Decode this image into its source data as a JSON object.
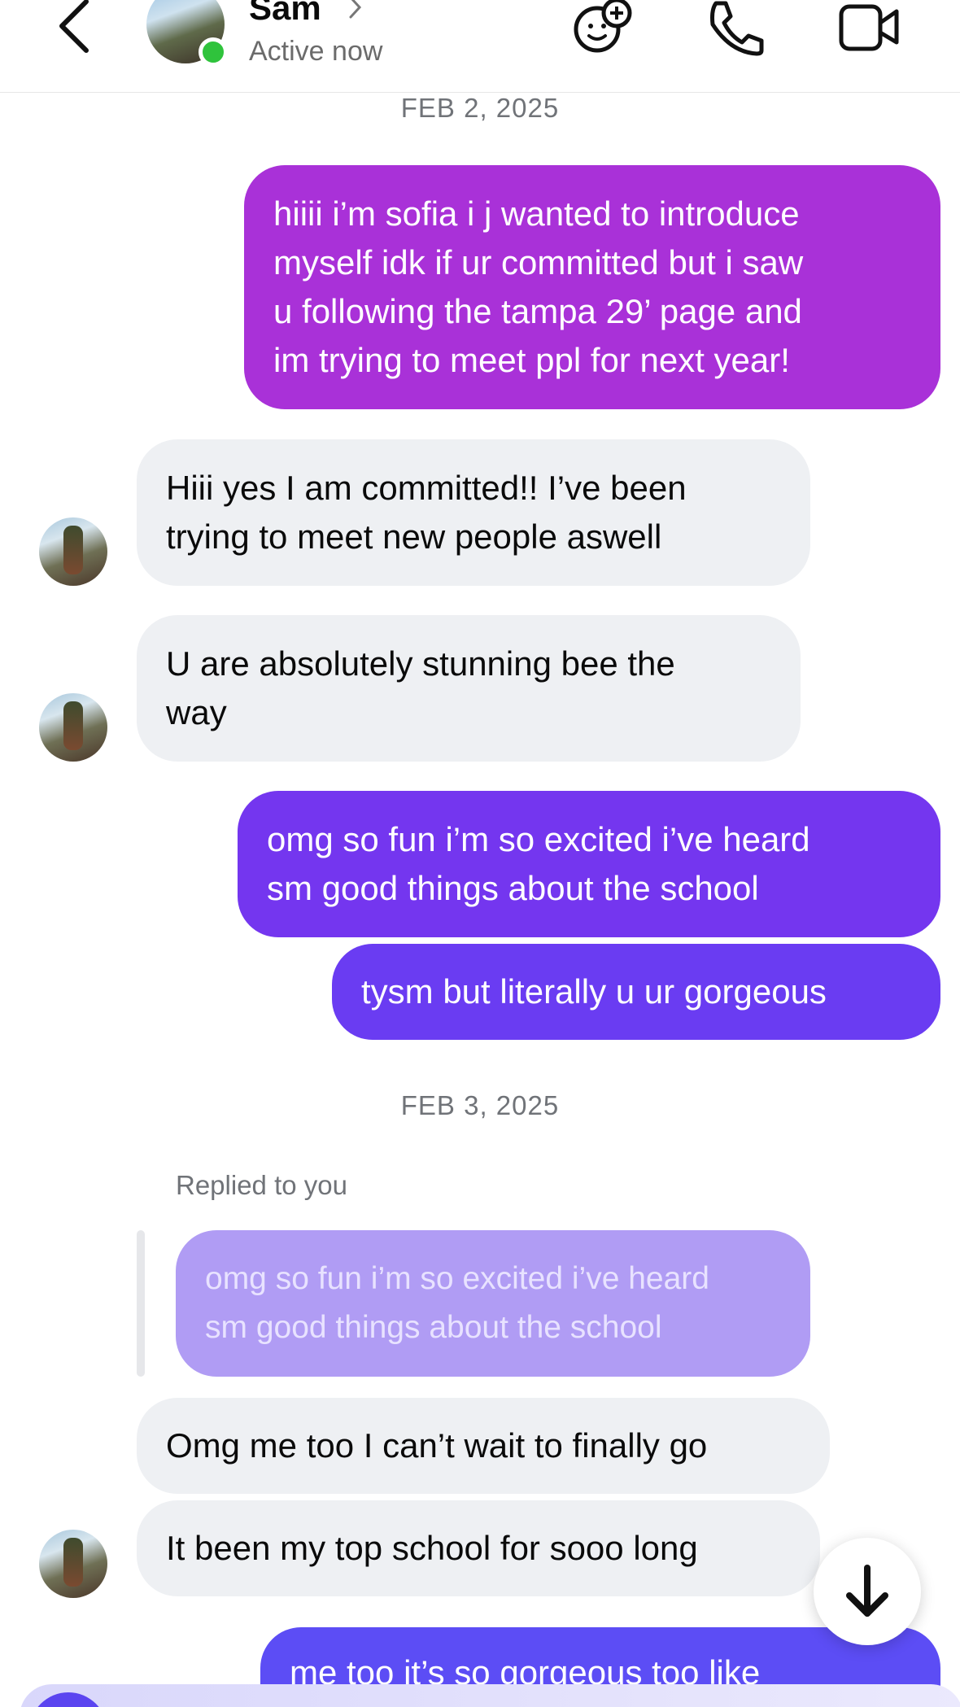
{
  "header": {
    "contact_name": "Sam",
    "status": "Active now",
    "icons": [
      "back-chevron-icon",
      "effects-icon",
      "phone-icon",
      "video-camera-icon"
    ]
  },
  "thread": {
    "date_1": "FEB 2, 2025",
    "date_2": "FEB 3, 2025",
    "messages": [
      {
        "from": "me",
        "text": "hiiii i’m sofia i j wanted to introduce\nmyself idk if ur committed but i saw\nu following the tampa 29’ page and\nim trying to meet ppl for next year!"
      },
      {
        "from": "sam",
        "text": "Hiii yes I am committed!! I’ve been\ntrying to meet new people aswell"
      },
      {
        "from": "sam",
        "text": "U are absolutely stunning bee the\nway"
      },
      {
        "from": "me",
        "text": "omg so fun i’m so excited i’ve heard\nsm good things about the school"
      },
      {
        "from": "me",
        "text": "tysm but literally u ur gorgeous"
      },
      {
        "from": "sam",
        "text": "Omg me too I can’t wait to finally go"
      },
      {
        "from": "sam",
        "text": "It been my top school for sooo long"
      },
      {
        "from": "me",
        "text": "me too it’s so gorgeous too like"
      }
    ],
    "reply_label": "Replied to you",
    "quoted_text": "omg so fun i’m so excited i’ve heard\nsm good things about the school"
  },
  "colors": {
    "sent_1": "#a931d8",
    "sent_2": "#7436ef",
    "sent_3": "#5c4df5",
    "received_bg": "#eef0f3",
    "online": "#2fc33c"
  }
}
